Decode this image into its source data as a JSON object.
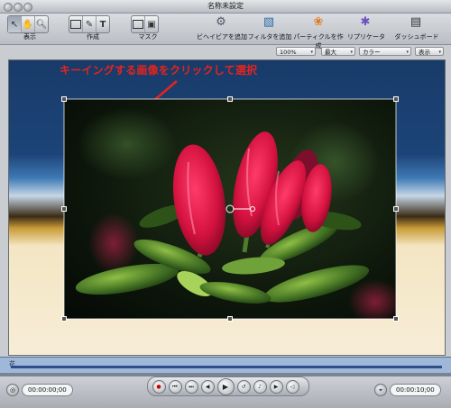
{
  "window": {
    "title": "名称未設定"
  },
  "toolbar": {
    "groups": [
      {
        "label": "表示"
      },
      {
        "label": "作成"
      },
      {
        "label": "マスク"
      }
    ],
    "actions": [
      {
        "label": "ビヘイビアを追加",
        "icon": "gear-icon"
      },
      {
        "label": "フィルタを追加",
        "icon": "filter-icon"
      },
      {
        "label": "パーティクルを作成",
        "icon": "particles-icon"
      },
      {
        "label": "リプリケータ",
        "icon": "replicator-icon"
      },
      {
        "label": "ダッシュボード",
        "icon": "dashboard-icon"
      }
    ]
  },
  "popups": {
    "zoom": "100%",
    "quality": "最大",
    "color": "カラー",
    "view": "表示"
  },
  "canvas": {
    "instruction": "キーイングする画像をクリックして選択"
  },
  "timeline": {
    "track_label": "花"
  },
  "transport": {
    "current_time": "00:00:00;00",
    "duration": "00:00:10;00"
  },
  "colors": {
    "instruction_text": "#e8231c",
    "accent": "#2c4f8a"
  }
}
